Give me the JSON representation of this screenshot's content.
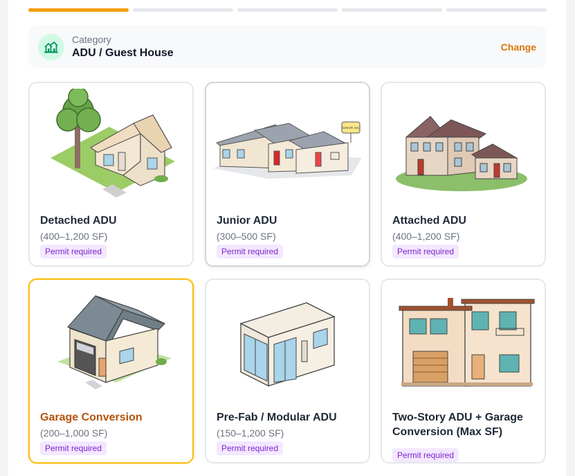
{
  "progress": {
    "steps": 5,
    "active_step": 1
  },
  "category": {
    "label": "Category",
    "value": "ADU / Guest House",
    "icon": "house-icon",
    "change_label": "Change"
  },
  "options": [
    {
      "title": "Detached ADU",
      "size": "(400–1,200 SF)",
      "badge": "Permit required",
      "state": "normal"
    },
    {
      "title": "Junior ADU",
      "size": "(300–500 SF)",
      "badge": "Permit required",
      "state": "hovered",
      "sign_text": "JUNIOR ADU"
    },
    {
      "title": "Attached ADU",
      "size": "(400–1,200 SF)",
      "badge": "Permit required",
      "state": "normal"
    },
    {
      "title": "Garage Conversion",
      "size": "(200–1,000 SF)",
      "badge": "Permit required",
      "state": "selected"
    },
    {
      "title": "Pre-Fab / Modular ADU",
      "size": "(150–1,200 SF)",
      "badge": "Permit required",
      "state": "normal"
    },
    {
      "title": "Two-Story ADU + Garage Conversion (Max SF)",
      "size": "",
      "badge": "Permit required",
      "state": "normal"
    }
  ],
  "colors": {
    "accent": "#f59e0b",
    "change": "#d97706",
    "badge_text": "#7e22ce",
    "badge_bg": "#f3e8ff",
    "icon_bg": "#d1fae5"
  }
}
